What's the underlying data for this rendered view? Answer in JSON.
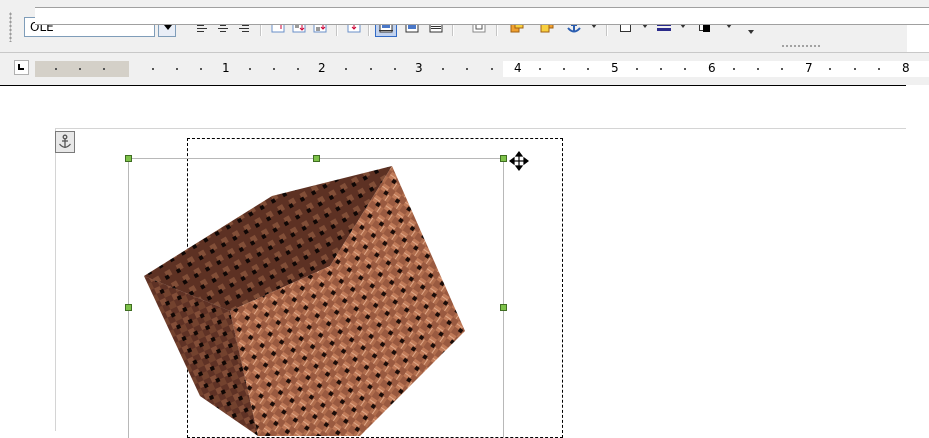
{
  "toolbar": {
    "style_value": "OLE",
    "buttons": [
      {
        "name": "align-left-icon"
      },
      {
        "name": "align-center-icon"
      },
      {
        "name": "align-right-icon"
      },
      {
        "name": "align-top-icon"
      },
      {
        "name": "align-middle-icon"
      },
      {
        "name": "align-bottom-icon"
      },
      {
        "name": "wrap-off-icon",
        "active": true
      },
      {
        "name": "wrap-page-icon"
      },
      {
        "name": "wrap-through-icon"
      },
      {
        "name": "frame-properties-icon"
      },
      {
        "name": "bring-to-front-icon"
      },
      {
        "name": "send-to-back-icon"
      },
      {
        "name": "anchor-icon"
      },
      {
        "name": "borders-icon"
      },
      {
        "name": "line-style-icon"
      },
      {
        "name": "border-color-icon"
      }
    ]
  },
  "ruler": {
    "labels": [
      "1",
      "2",
      "3",
      "4",
      "5",
      "6",
      "7",
      "8"
    ]
  },
  "colors": {
    "toolbar_bg": "#f0f0f0",
    "handle_fill": "#7ec24a",
    "active_button": "#c1d2ee",
    "cube_base": "#8a4a33"
  },
  "document": {
    "object": "cube-image"
  }
}
